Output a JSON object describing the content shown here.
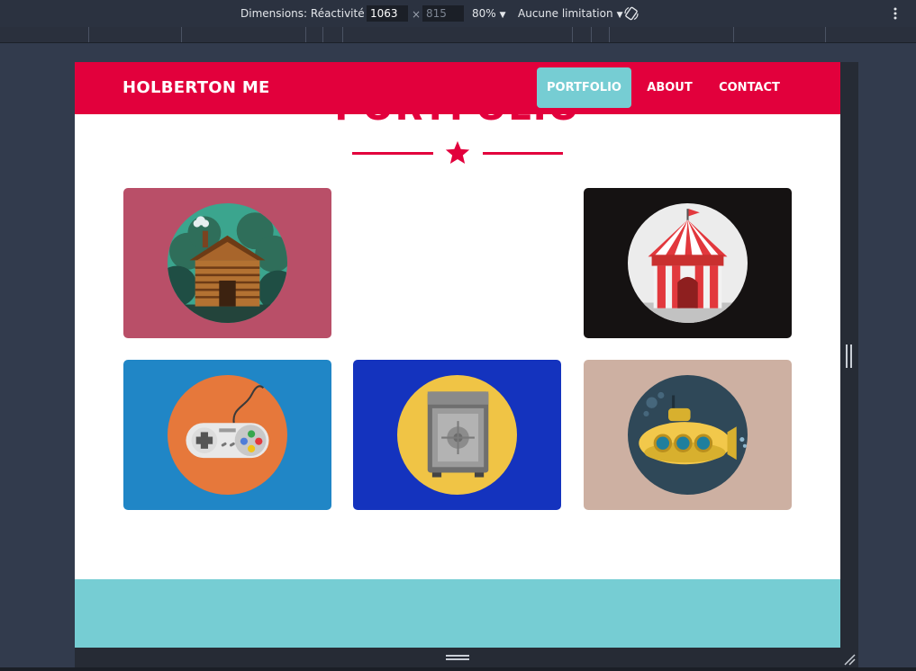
{
  "devtools": {
    "dimensions_label": "Dimensions: Réactivité",
    "width_value": "1063",
    "times": "×",
    "height_value": "815",
    "zoom": "80%",
    "throttle": "Aucune limitation",
    "rotate_icon": "rotate-icon",
    "menu_icon": "kebab-icon"
  },
  "site": {
    "brand": "HOLBERTON ME",
    "nav": [
      {
        "label": "PORTFOLIO",
        "active": true
      },
      {
        "label": "ABOUT",
        "active": false
      },
      {
        "label": "CONTACT",
        "active": false
      }
    ],
    "section_title": "PORTFOLIO",
    "divider_icon": "star-icon",
    "colors": {
      "primary": "#e2003c",
      "accent": "#76cdd3"
    },
    "portfolio": [
      {
        "name": "cabin",
        "bg": "#b94f68"
      },
      {
        "name": "circus",
        "bg": "#151212"
      },
      {
        "name": "game-controller",
        "bg": "#2086c6"
      },
      {
        "name": "safe",
        "bg": "#1433be"
      },
      {
        "name": "submarine",
        "bg": "#cdb0a2"
      }
    ]
  }
}
